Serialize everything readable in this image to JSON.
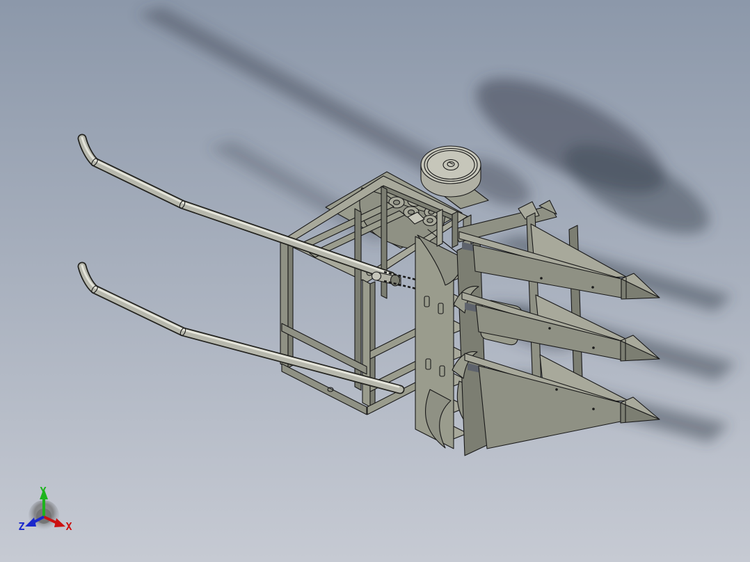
{
  "viewport": {
    "kind": "cad-3d-shaded-view",
    "content": "3D CAD assembly of a small walk-behind corn harvester header: tubular support cage, gearbox plate with bosses, flat drive disc wheel, chain drive, serrated cutter-bar plate, three pointed gatherer snouts and two long handlebars, casting soft shadows"
  },
  "palette": {
    "bg_top": "#8C98AA",
    "bg_bottom": "#C6CAD3",
    "edge": "#191919",
    "face_top": "#A8A99B",
    "face_mid": "#9A9C8D",
    "face_side": "#8F9184",
    "face_dark": "#7C7E72",
    "gap_dark": "#5E636C",
    "metal_top": "#C6C6BA",
    "metal_side": "#B0B0A4",
    "tube": "#B7B8AD",
    "tube_hi": "#E9E9DF",
    "tube_edge": "#23231F",
    "shadow": "#3E4553"
  },
  "model": {
    "parts": [
      "handlebar-upper",
      "handlebar-lower",
      "support-frame-cage",
      "gearbox-plate",
      "pulley-bosses",
      "drive-disc-wheel",
      "chain-drive",
      "cutter-bar-plate",
      "gatherer-snout-1",
      "gatherer-snout-2",
      "gatherer-snout-3",
      "snout-tip-cones",
      "finger-blades",
      "gathering-shoes",
      "rear-standards",
      "cast-shadows"
    ]
  },
  "axis_triad": {
    "x": {
      "label": "X",
      "color": "#CC1111"
    },
    "y": {
      "label": "Y",
      "color": "#1DB41D"
    },
    "z": {
      "label": "Z",
      "color": "#1A28CC"
    }
  }
}
